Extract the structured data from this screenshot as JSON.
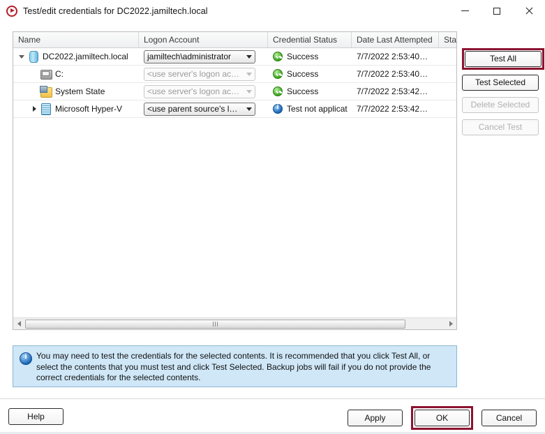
{
  "window": {
    "title": "Test/edit credentials for DC2022.jamiltech.local",
    "icon": "app-record-icon",
    "controls": {
      "minimize": "minimize-icon",
      "maximize": "maximize-icon",
      "close": "close-icon"
    }
  },
  "list": {
    "columns": [
      {
        "key": "name",
        "label": "Name"
      },
      {
        "key": "logon",
        "label": "Logon Account"
      },
      {
        "key": "cred",
        "label": "Credential Status"
      },
      {
        "key": "date",
        "label": "Date Last Attempted"
      },
      {
        "key": "state",
        "label": "State"
      }
    ],
    "rows": [
      {
        "name": "DC2022.jamiltech.local",
        "icon": "server-icon",
        "indent": 0,
        "twisty": "expanded",
        "logon": "jamiltech\\administrator",
        "logon_enabled": true,
        "status_icon": "success-icon",
        "cred": "Success",
        "date": "7/7/2022 2:53:40…",
        "state": ""
      },
      {
        "name": "C:",
        "icon": "drive-icon",
        "indent": 1,
        "twisty": "none",
        "logon": "<use server's logon ac…",
        "logon_enabled": false,
        "status_icon": "success-icon",
        "cred": "Success",
        "date": "7/7/2022 2:53:40…",
        "state": ""
      },
      {
        "name": "System State",
        "icon": "system-state-icon",
        "indent": 1,
        "twisty": "none",
        "logon": "<use server's logon ac…",
        "logon_enabled": false,
        "status_icon": "success-icon",
        "cred": "Success",
        "date": "7/7/2022 2:53:42…",
        "state": ""
      },
      {
        "name": "Microsoft Hyper-V",
        "icon": "hyperv-icon",
        "indent": 1,
        "twisty": "collapsed",
        "logon": "<use parent source's l…",
        "logon_enabled": true,
        "status_icon": "info-icon",
        "cred": "Test not applicat",
        "date": "7/7/2022 2:53:42…",
        "state": ""
      }
    ]
  },
  "side_buttons": [
    {
      "label": "Test All",
      "enabled": true,
      "highlighted": true
    },
    {
      "label": "Test Selected",
      "enabled": true,
      "highlighted": false
    },
    {
      "label": "Delete Selected",
      "enabled": false,
      "highlighted": false
    },
    {
      "label": "Cancel Test",
      "enabled": false,
      "highlighted": false
    }
  ],
  "info": {
    "icon": "info-icon",
    "text": "You may need to test the credentials for the selected contents. It is recommended that you click Test All, or select the contents that you must test and click Test Selected. Backup jobs will fail if you do not provide the correct credentials for the selected contents."
  },
  "footer": {
    "help": "Help",
    "apply": "Apply",
    "ok": "OK",
    "cancel": "Cancel",
    "ok_highlighted": true
  },
  "colors": {
    "highlight": "#8c1230",
    "info_background": "#cfe7f7",
    "success": "#39a519",
    "info_blue": "#1763b8"
  }
}
